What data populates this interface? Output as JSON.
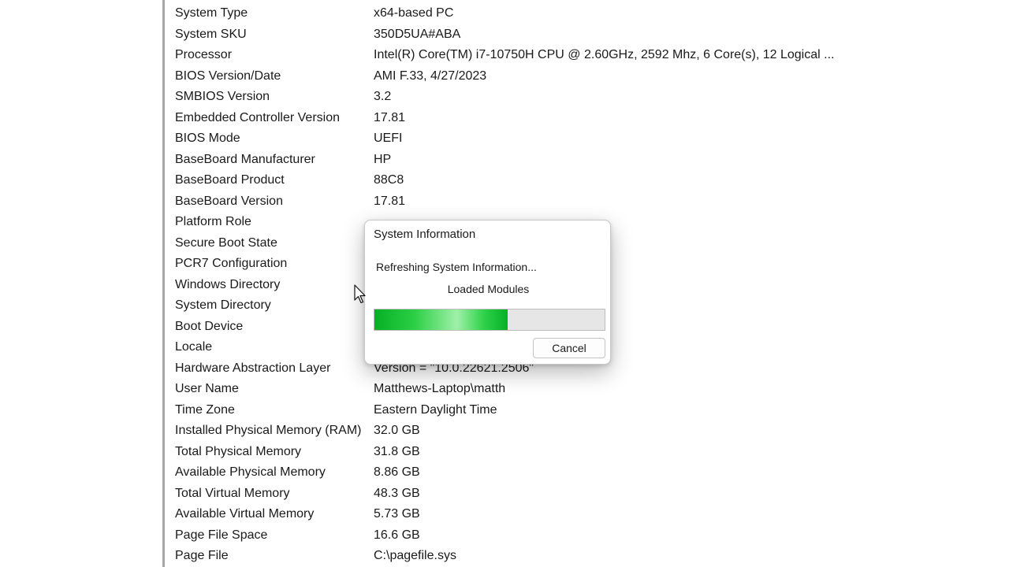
{
  "system_summary": {
    "rows": [
      {
        "item": "System Type",
        "value": "x64-based PC"
      },
      {
        "item": "System SKU",
        "value": "350D5UA#ABA"
      },
      {
        "item": "Processor",
        "value": "Intel(R) Core(TM) i7-10750H CPU @ 2.60GHz, 2592 Mhz, 6 Core(s), 12 Logical ..."
      },
      {
        "item": "BIOS Version/Date",
        "value": "AMI F.33, 4/27/2023"
      },
      {
        "item": "SMBIOS Version",
        "value": "3.2"
      },
      {
        "item": "Embedded Controller Version",
        "value": "17.81"
      },
      {
        "item": "BIOS Mode",
        "value": "UEFI"
      },
      {
        "item": "BaseBoard Manufacturer",
        "value": "HP"
      },
      {
        "item": "BaseBoard Product",
        "value": "88C8"
      },
      {
        "item": "BaseBoard Version",
        "value": "17.81"
      },
      {
        "item": "Platform Role",
        "value": ""
      },
      {
        "item": "Secure Boot State",
        "value": ""
      },
      {
        "item": "PCR7 Configuration",
        "value": ""
      },
      {
        "item": "Windows Directory",
        "value": ""
      },
      {
        "item": "System Directory",
        "value": ""
      },
      {
        "item": "Boot Device",
        "value": ""
      },
      {
        "item": "Locale",
        "value": ""
      },
      {
        "item": "Hardware Abstraction Layer",
        "value": "Version = \"10.0.22621.2506\""
      },
      {
        "item": "User Name",
        "value": "Matthews-Laptop\\matth"
      },
      {
        "item": "Time Zone",
        "value": "Eastern Daylight Time"
      },
      {
        "item": "Installed Physical Memory (RAM)",
        "value": "32.0 GB"
      },
      {
        "item": "Total Physical Memory",
        "value": "31.8 GB"
      },
      {
        "item": "Available Physical Memory",
        "value": "8.86 GB"
      },
      {
        "item": "Total Virtual Memory",
        "value": "48.3 GB"
      },
      {
        "item": "Available Virtual Memory",
        "value": "5.73 GB"
      },
      {
        "item": "Page File Space",
        "value": "16.6 GB"
      },
      {
        "item": "Page File",
        "value": "C:\\pagefile.sys"
      }
    ]
  },
  "dialog": {
    "title": "System Information",
    "status": "Refreshing System Information...",
    "module": "Loaded Modules",
    "progress_fraction": 0.58,
    "cancel_label": "Cancel"
  },
  "icons": {
    "cursor": "mouse-pointer-icon"
  },
  "colors": {
    "progress_green": "#06b025",
    "divider": "#a7a7a7"
  }
}
